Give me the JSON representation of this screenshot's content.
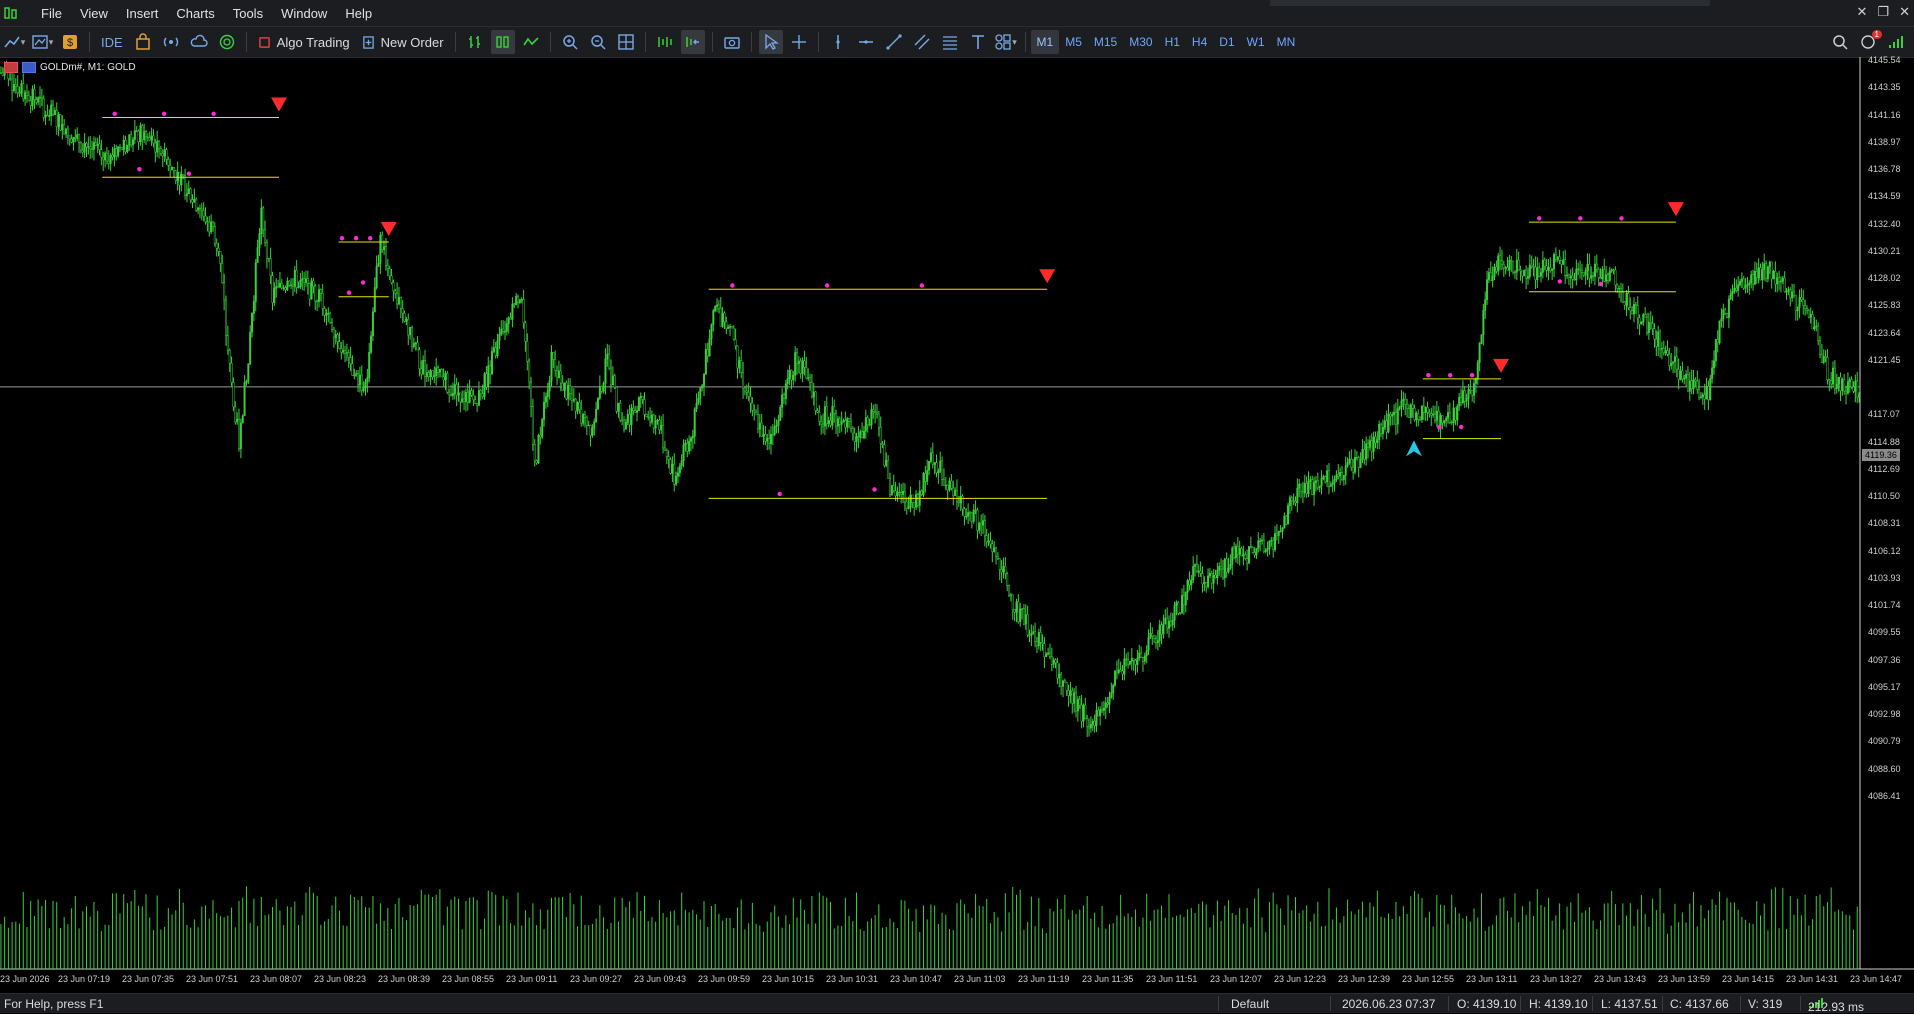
{
  "menu": [
    "File",
    "View",
    "Insert",
    "Charts",
    "Tools",
    "Window",
    "Help"
  ],
  "toolbar": {
    "ide_label": "IDE",
    "algo_trading_label": "Algo Trading",
    "new_order_label": "New Order",
    "timeframes": [
      "M1",
      "M5",
      "M15",
      "M30",
      "H1",
      "H4",
      "D1",
      "W1",
      "MN"
    ],
    "active_timeframe": "M1",
    "notification_count": "1"
  },
  "chart": {
    "symbol_label": "GOLDm#, M1:  GOLD",
    "current_price": "4119.36",
    "price_axis": [
      "4145.54",
      "4143.35",
      "4141.16",
      "4138.97",
      "4136.78",
      "4134.59",
      "4132.40",
      "4130.21",
      "4128.02",
      "4125.83",
      "4123.64",
      "4121.45",
      "4117.07",
      "4114.88",
      "4112.69",
      "4110.50",
      "4108.31",
      "4106.12",
      "4103.93",
      "4101.74",
      "4099.55",
      "4097.36",
      "4095.17",
      "4092.98",
      "4090.79",
      "4088.60",
      "4086.41"
    ],
    "time_axis": [
      "23 Jun 2026",
      "23 Jun 07:19",
      "23 Jun 07:35",
      "23 Jun 07:51",
      "23 Jun 08:07",
      "23 Jun 08:23",
      "23 Jun 08:39",
      "23 Jun 08:55",
      "23 Jun 09:11",
      "23 Jun 09:27",
      "23 Jun 09:43",
      "23 Jun 09:59",
      "23 Jun 10:15",
      "23 Jun 10:31",
      "23 Jun 10:47",
      "23 Jun 11:03",
      "23 Jun 11:19",
      "23 Jun 11:35",
      "23 Jun 11:51",
      "23 Jun 12:07",
      "23 Jun 12:23",
      "23 Jun 12:39",
      "23 Jun 12:55",
      "23 Jun 13:11",
      "23 Jun 13:27",
      "23 Jun 13:43",
      "23 Jun 13:59",
      "23 Jun 14:15",
      "23 Jun 14:31",
      "23 Jun 14:47"
    ],
    "colors": {
      "bull": "#3bd13b",
      "bear": "#3bd13b",
      "volume": "#3bd13b",
      "level": "#e6e600",
      "dot": "#ff2bd6",
      "arrow_sell": "#ff2a2a",
      "arrow_buy": "#26c6e6"
    }
  },
  "chart_data": {
    "type": "candlestick",
    "series": [
      {
        "name": "GOLD",
        "path": [
          [
            0,
            4144.6
          ],
          [
            20,
            4142.2
          ],
          [
            40,
            4139.4
          ],
          [
            55,
            4137.8
          ],
          [
            75,
            4139.6
          ],
          [
            85,
            4138.6
          ],
          [
            100,
            4135.2
          ],
          [
            108,
            4133.6
          ],
          [
            117,
            4131.0
          ],
          [
            122,
            4122.0
          ],
          [
            128,
            4114.8
          ],
          [
            133,
            4122.0
          ],
          [
            140,
            4133.6
          ],
          [
            146,
            4126.6
          ],
          [
            156,
            4128.2
          ],
          [
            172,
            4126.6
          ],
          [
            188,
            4121.0
          ],
          [
            196,
            4119.2
          ],
          [
            204,
            4131.6
          ],
          [
            214,
            4125.8
          ],
          [
            226,
            4121.0
          ],
          [
            240,
            4119.6
          ],
          [
            256,
            4118.0
          ],
          [
            270,
            4124.0
          ],
          [
            280,
            4127.0
          ],
          [
            287,
            4113.0
          ],
          [
            296,
            4121.4
          ],
          [
            306,
            4118.4
          ],
          [
            318,
            4116.0
          ],
          [
            326,
            4121.6
          ],
          [
            334,
            4116.0
          ],
          [
            342,
            4118.2
          ],
          [
            354,
            4116.0
          ],
          [
            362,
            4112.0
          ],
          [
            372,
            4116.0
          ],
          [
            384,
            4125.6
          ],
          [
            392,
            4124.0
          ],
          [
            402,
            4118.0
          ],
          [
            412,
            4115.0
          ],
          [
            420,
            4118.2
          ],
          [
            428,
            4122.0
          ],
          [
            440,
            4117.0
          ],
          [
            452,
            4117.0
          ],
          [
            460,
            4114.8
          ],
          [
            470,
            4118.0
          ],
          [
            478,
            4111.2
          ],
          [
            486,
            4110.4
          ],
          [
            492,
            4110.0
          ],
          [
            500,
            4114.0
          ],
          [
            512,
            4110.8
          ],
          [
            528,
            4108.0
          ],
          [
            538,
            4104.6
          ],
          [
            546,
            4101.4
          ],
          [
            556,
            4099.4
          ],
          [
            566,
            4096.8
          ],
          [
            576,
            4094.2
          ],
          [
            584,
            4092.6
          ],
          [
            592,
            4092.8
          ],
          [
            600,
            4096.4
          ],
          [
            612,
            4097.6
          ],
          [
            624,
            4100.0
          ],
          [
            634,
            4101.6
          ],
          [
            642,
            4104.6
          ],
          [
            652,
            4103.6
          ],
          [
            662,
            4105.8
          ],
          [
            672,
            4106.0
          ],
          [
            684,
            4106.6
          ],
          [
            696,
            4110.8
          ],
          [
            706,
            4111.4
          ],
          [
            718,
            4112.4
          ],
          [
            730,
            4113.4
          ],
          [
            742,
            4116.0
          ],
          [
            754,
            4117.6
          ],
          [
            766,
            4117.4
          ],
          [
            774,
            4116.4
          ],
          [
            782,
            4117.4
          ],
          [
            792,
            4119.6
          ],
          [
            800,
            4128.4
          ],
          [
            806,
            4129.6
          ],
          [
            816,
            4129.0
          ],
          [
            826,
            4128.4
          ],
          [
            836,
            4129.8
          ],
          [
            846,
            4128.4
          ],
          [
            856,
            4128.8
          ],
          [
            866,
            4128.2
          ],
          [
            876,
            4126.0
          ],
          [
            884,
            4124.6
          ],
          [
            892,
            4123.0
          ],
          [
            900,
            4121.0
          ],
          [
            910,
            4119.2
          ],
          [
            918,
            4118.8
          ],
          [
            924,
            4124.4
          ],
          [
            934,
            4127.6
          ],
          [
            944,
            4128.6
          ],
          [
            952,
            4128.8
          ],
          [
            962,
            4126.4
          ],
          [
            972,
            4125.4
          ],
          [
            982,
            4120.6
          ],
          [
            990,
            4119.4
          ],
          [
            998,
            4119.0
          ]
        ]
      }
    ],
    "volume": "bars along the bottom of the chart",
    "levels": [
      {
        "start": 55,
        "end": 150,
        "top": 4141.0,
        "bottom": 4136.2
      },
      {
        "start": 182,
        "end": 209,
        "top": 4131.0,
        "bottom": 4126.6
      },
      {
        "start": 381,
        "end": 563,
        "top": 4127.2,
        "bottom": 4110.4
      },
      {
        "start": 765,
        "end": 807,
        "top": 4120.0,
        "bottom": 4115.2
      },
      {
        "start": 822,
        "end": 901,
        "top": 4132.6,
        "bottom": 4127.0
      }
    ]
  },
  "status": {
    "help": "For Help, press F1",
    "profile": "Default",
    "datetime": "2026.06.23 07:37",
    "open": "O: 4139.10",
    "high": "H: 4139.10",
    "low": "L: 4137.51",
    "close": "C: 4137.66",
    "volume": "V: 319",
    "ping": "212.93 ms"
  }
}
